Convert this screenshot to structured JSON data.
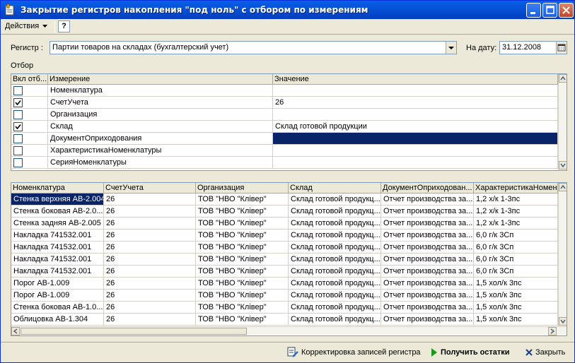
{
  "window": {
    "title": "Закрытие регистров накопления \"под ноль\" с отбором по измерениям"
  },
  "menu": {
    "actions_label": "Действия",
    "help_label": "?"
  },
  "form": {
    "register_label": "Регистр :",
    "register_value": "Партии товаров на складах (бухгалтерский учет)",
    "date_label": "На дату:",
    "date_value": "31.12.2008",
    "filter_label": "Отбор"
  },
  "filter_grid": {
    "columns": [
      "Вкл отб...",
      "Измерение",
      "Значение"
    ],
    "rows": [
      {
        "checked": false,
        "dimension": "Номенклатура",
        "value": ""
      },
      {
        "checked": true,
        "dimension": "СчетУчета",
        "value": "26"
      },
      {
        "checked": false,
        "dimension": "Организация",
        "value": ""
      },
      {
        "checked": true,
        "dimension": "Склад",
        "value": "Склад готовой продукции"
      },
      {
        "checked": false,
        "dimension": "ДокументОприходования",
        "value": "",
        "selected": true
      },
      {
        "checked": false,
        "dimension": "ХарактеристикаНоменклатуры",
        "value": ""
      },
      {
        "checked": false,
        "dimension": "СерияНоменклатуры",
        "value": ""
      }
    ]
  },
  "result_grid": {
    "columns": [
      "Номенклатура",
      "СчетУчета",
      "Организация",
      "Склад",
      "ДокументОприходован...",
      "ХарактеристикаНомен"
    ],
    "rows": [
      [
        "Стенка верхняя АВ-2.004",
        "26",
        "ТОВ \"НВО \"Клівер\"",
        "Склад готовой продукц...",
        "Отчет производства за...",
        "1,2 х/к 1-3пс"
      ],
      [
        "Стенка боковая АВ-2.0...",
        "26",
        "ТОВ \"НВО \"Клівер\"",
        "Склад готовой продукц...",
        "Отчет производства за...",
        "1,2 х/к 1-3пс"
      ],
      [
        "Стенка задняя АВ-2.005",
        "26",
        "ТОВ \"НВО \"Клівер\"",
        "Склад готовой продукц...",
        "Отчет производства за...",
        "1,2 х/к 1-3пс"
      ],
      [
        "Накладка 741532.001",
        "26",
        "ТОВ \"НВО \"Клівер\"",
        "Склад готовой продукц...",
        "Отчет производства за...",
        "6,0 г/к 3Сп"
      ],
      [
        "Накладка 741532.001",
        "26",
        "ТОВ \"НВО \"Клівер\"",
        "Склад готовой продукц...",
        "Отчет производства за...",
        "6,0 г/к 3Сп"
      ],
      [
        "Накладка 741532.001",
        "26",
        "ТОВ \"НВО \"Клівер\"",
        "Склад готовой продукц...",
        "Отчет производства за...",
        "6,0 г/к 3Сп"
      ],
      [
        "Накладка 741532.001",
        "26",
        "ТОВ \"НВО \"Клівер\"",
        "Склад готовой продукц...",
        "Отчет производства за...",
        "6,0 г/к 3Сп"
      ],
      [
        "Порог АВ-1.009",
        "26",
        "ТОВ \"НВО \"Клівер\"",
        "Склад готовой продукц...",
        "Отчет производства за...",
        "1,5 хол/к 3пс"
      ],
      [
        "Порог АВ-1.009",
        "26",
        "ТОВ \"НВО \"Клівер\"",
        "Склад готовой продукц...",
        "Отчет производства за...",
        "1,5 хол/к 3пс"
      ],
      [
        "Стенка боковая АВ-1.0...",
        "26",
        "ТОВ \"НВО \"Клівер\"",
        "Склад готовой продукц...",
        "Отчет производства за...",
        "1,5 хол/к 3пс"
      ],
      [
        "Облицовка АВ-1.304",
        "26",
        "ТОВ \"НВО \"Клівер\"",
        "Склад готовой продукц...",
        "Отчет производства за...",
        "1,5 хол/к 3пс"
      ]
    ]
  },
  "footer": {
    "correct_label": "Корректировка записей регистра",
    "get_balances_label": "Получить остатки",
    "close_label": "Закрыть"
  },
  "colors": {
    "titlebar": "#0552d7",
    "selection": "#0a246a",
    "run_icon": "#1a9a1a",
    "close_icon": "#1a3a8a"
  },
  "icons": [
    "app-icon",
    "minimize-icon",
    "maximize-icon",
    "close-icon",
    "help-icon",
    "dropdown-arrow-icon",
    "calendar-icon",
    "checkmark-icon",
    "scroll-up-icon",
    "scroll-down-icon",
    "scroll-left-icon",
    "scroll-right-icon",
    "register-edit-icon",
    "run-icon",
    "close-x-icon"
  ]
}
